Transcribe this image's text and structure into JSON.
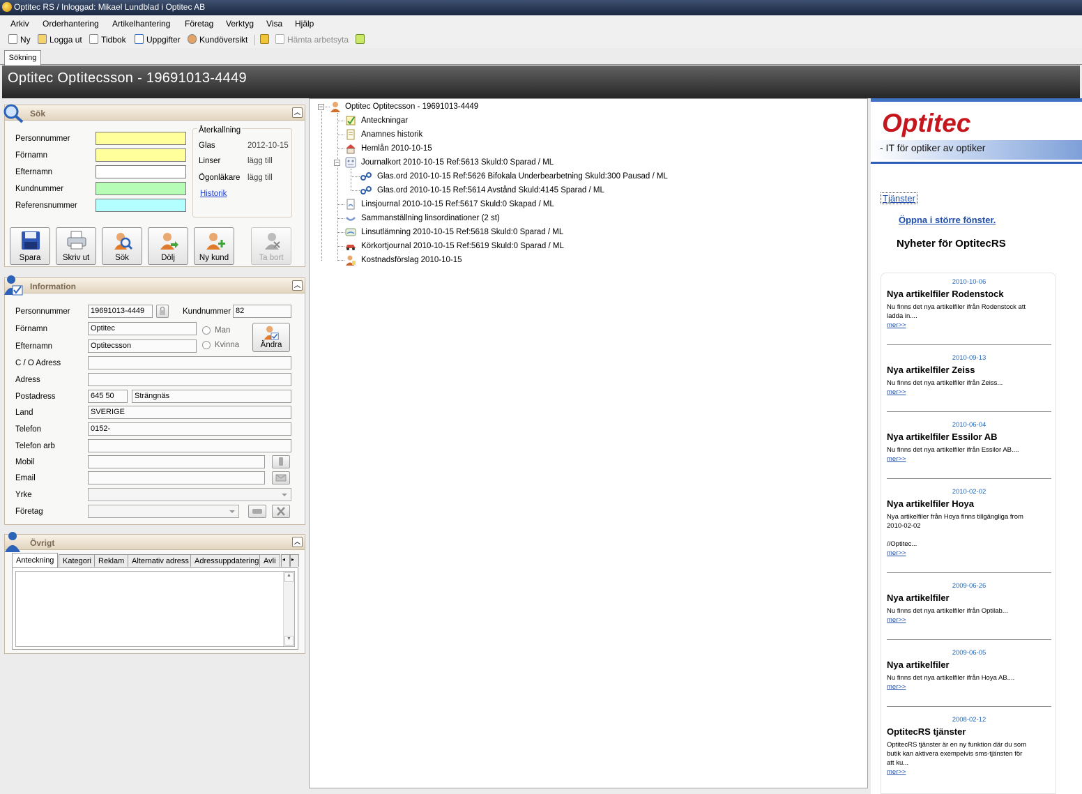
{
  "window": {
    "title": "Optitec RS / Inloggad: Mikael Lundblad i  Optitec AB"
  },
  "menu": [
    "Arkiv",
    "Orderhantering",
    "Artikelhantering",
    "Företag",
    "Verktyg",
    "Visa",
    "Hjälp"
  ],
  "toolbar": {
    "new": "Ny",
    "logout": "Logga ut",
    "timebook": "Tidbok",
    "tasks": "Uppgifter",
    "customer_overview": "Kundöversikt",
    "fetch_workspace": "Hämta arbetsyta"
  },
  "tab": "Sökning",
  "header": {
    "title": "Optitec Optitecsson - 19691013-4449"
  },
  "search": {
    "title": "Sök",
    "labels": {
      "ssn": "Personnummer",
      "first": "Förnamn",
      "last": "Efternamn",
      "custno": "Kundnummer",
      "ref": "Referensnummer"
    },
    "recall": {
      "title": "Återkallning",
      "glas_label": "Glas",
      "glas_value": "2012-10-15",
      "linser_label": "Linser",
      "linser_value": "lägg till",
      "ogon_label": "Ögonläkare",
      "ogon_value": "lägg till",
      "history_link": "Historik"
    },
    "buttons": {
      "save": "Spara",
      "print": "Skriv ut",
      "search": "Sök",
      "hide": "Dölj",
      "new_customer": "Ny kund",
      "delete": "Ta bort"
    }
  },
  "info": {
    "title": "Information",
    "labels": {
      "ssn": "Personnummer",
      "custno": "Kundnummer",
      "first": "Förnamn",
      "last": "Efternamn",
      "co": "C / O Adress",
      "address": "Adress",
      "postal": "Postadress",
      "country": "Land",
      "phone": "Telefon",
      "phone_work": "Telefon arb",
      "mobile": "Mobil",
      "email": "Email",
      "occupation": "Yrke",
      "company": "Företag",
      "male": "Man",
      "female": "Kvinna",
      "change": "Ändra"
    },
    "values": {
      "ssn": "19691013-4449",
      "custno": "82",
      "first": "Optitec",
      "last": "Optitecsson",
      "co": "",
      "address": "",
      "zip": "645 50",
      "city": "Strängnäs",
      "country": "SVERIGE",
      "phone": "0152-",
      "phone_work": "",
      "mobile": "",
      "email": ""
    }
  },
  "other": {
    "title": "Övrigt",
    "tabs": [
      "Anteckning",
      "Kategori",
      "Reklam",
      "Alternativ adress",
      "Adressuppdatering",
      "Avli"
    ]
  },
  "tree": {
    "root": "Optitec Optitecsson - 19691013-4449",
    "items": [
      "Anteckningar",
      "Anamnes historik",
      "Hemlån  2010-10-15",
      "Journalkort  2010-10-15 Ref:5613 Skuld:0 Sparad / ML",
      "Glas.ord  2010-10-15 Ref:5626 Bifokala Underbearbetning Skuld:300 Pausad / ML",
      "Glas.ord  2010-10-15 Ref:5614 Avstånd Skuld:4145 Sparad / ML",
      "Linsjournal  2010-10-15 Ref:5617 Skuld:0 Skapad / ML",
      "Sammanställning linsordinationer (2 st)",
      "Linsutlämning  2010-10-15 Ref:5618 Skuld:0 Sparad / ML",
      "Körkortjournal  2010-10-15 Ref:5619 Skuld:0 Sparad / ML",
      "Kostnadsförslag  2010-10-15"
    ]
  },
  "sidebar": {
    "logo": "Optitec",
    "tagline": "- IT för optiker av optiker",
    "services": "Tjänster",
    "open_larger": "Öppna i större fönster.",
    "news_heading": "Nyheter för OptitecRS",
    "news": [
      {
        "date": "2010-10-06",
        "title": "Nya artikelfiler Rodenstock",
        "text": "Nu finns det nya artikelfiler ifrån Rodenstock att ladda in....",
        "more": "mer>>"
      },
      {
        "date": "2010-09-13",
        "title": "Nya artikelfiler Zeiss",
        "text": "Nu finns det nya artikelfiler ifrån Zeiss...",
        "more": "mer>>"
      },
      {
        "date": "2010-06-04",
        "title": "Nya artikelfiler Essilor AB",
        "text": "Nu finns det nya artikelfiler ifrån Essilor AB....",
        "more": "mer>>"
      },
      {
        "date": "2010-02-02",
        "title": "Nya artikelfiler Hoya",
        "text": "Nya artikelfiler från Hoya finns tillgängliga from 2010-02-02",
        "text2": "//Optitec...",
        "more": "mer>>"
      },
      {
        "date": "2009-06-26",
        "title": "Nya artikelfiler",
        "text": "Nu finns det nya artikelfiler ifrån Optilab...",
        "more": "mer>>"
      },
      {
        "date": "2009-06-05",
        "title": "Nya artikelfiler",
        "text": "Nu finns det nya artikelfiler ifrån Hoya AB....",
        "more": "mer>>"
      },
      {
        "date": "2008-02-12",
        "title": "OptitecRS tjänster",
        "text": "OptitecRS tjänster är en ny funktion där du som butik kan aktivera exempelvis sms-tjänsten för att ku...",
        "more": "mer>>"
      }
    ]
  },
  "colors": {
    "title_bar": "#1f2d48",
    "header": "#3e3e3e",
    "brand_red": "#c5161d",
    "link_blue": "#1f4fa8",
    "panel_border": "#c9b9a3",
    "yellow_field": "#ffff9c",
    "green_field": "#b6fbb6",
    "cyan_field": "#b3ffff"
  }
}
